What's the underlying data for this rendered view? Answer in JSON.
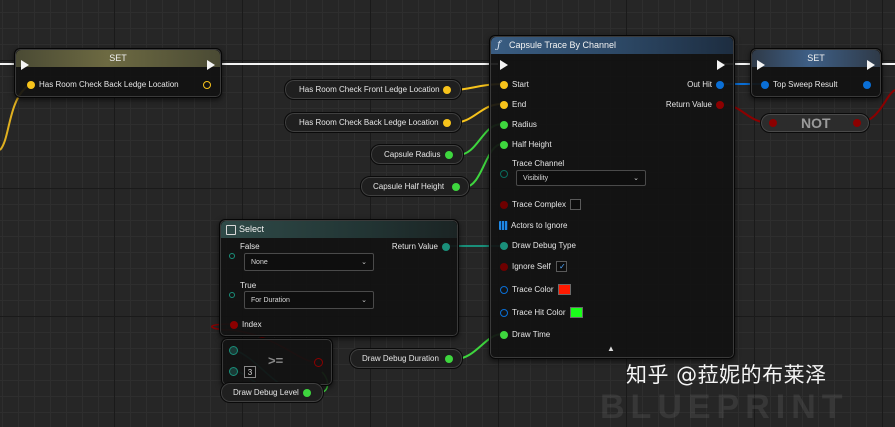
{
  "graph": {
    "set_left": {
      "title": "SET",
      "pin_label": "Has Room Check Back Ledge Location"
    },
    "capsule_trace": {
      "title": "Capsule Trace By Channel",
      "inputs": {
        "start": "Start",
        "end": "End",
        "radius": "Radius",
        "half_height": "Half Height",
        "trace_channel": "Trace Channel",
        "trace_channel_value": "Visibility",
        "trace_complex": "Trace Complex",
        "actors_to_ignore": "Actors to Ignore",
        "draw_debug_type": "Draw Debug Type",
        "ignore_self": "Ignore Self",
        "trace_color": "Trace Color",
        "trace_hit_color": "Trace Hit Color",
        "draw_time": "Draw Time"
      },
      "outputs": {
        "out_hit": "Out Hit",
        "return_value": "Return Value"
      },
      "trace_complex_checked": false,
      "ignore_self_checked": true,
      "trace_color": "#ff1a00",
      "trace_hit_color": "#1aff1a"
    },
    "set_right": {
      "title": "SET",
      "pin_label": "Top Sweep Result"
    },
    "not_node": {
      "label": "NOT"
    },
    "variables": {
      "front_ledge": "Has Room Check Front Ledge Location",
      "back_ledge": "Has Room Check Back Ledge Location",
      "capsule_radius": "Capsule Radius",
      "capsule_half_height": "Capsule Half Height",
      "draw_debug_duration": "Draw Debug Duration",
      "draw_debug_level": "Draw Debug Level"
    },
    "select": {
      "title": "Select",
      "false_label": "False",
      "false_value": "None",
      "true_label": "True",
      "true_value": "For Duration",
      "index_label": "Index",
      "return_value": "Return Value"
    },
    "compare": {
      "operator": ">=",
      "value": "3"
    }
  },
  "watermark": "知乎 @菈妮的布莱泽",
  "background_mark": "BLUEPRINT",
  "colors": {
    "exec": "#f4f4f4",
    "vector": "#f7c31b",
    "float": "#3ed63e",
    "bool": "#8c0000",
    "struct": "#0a6fd6",
    "enum": "#0a6b5c",
    "byte": "#1a8f7a"
  }
}
